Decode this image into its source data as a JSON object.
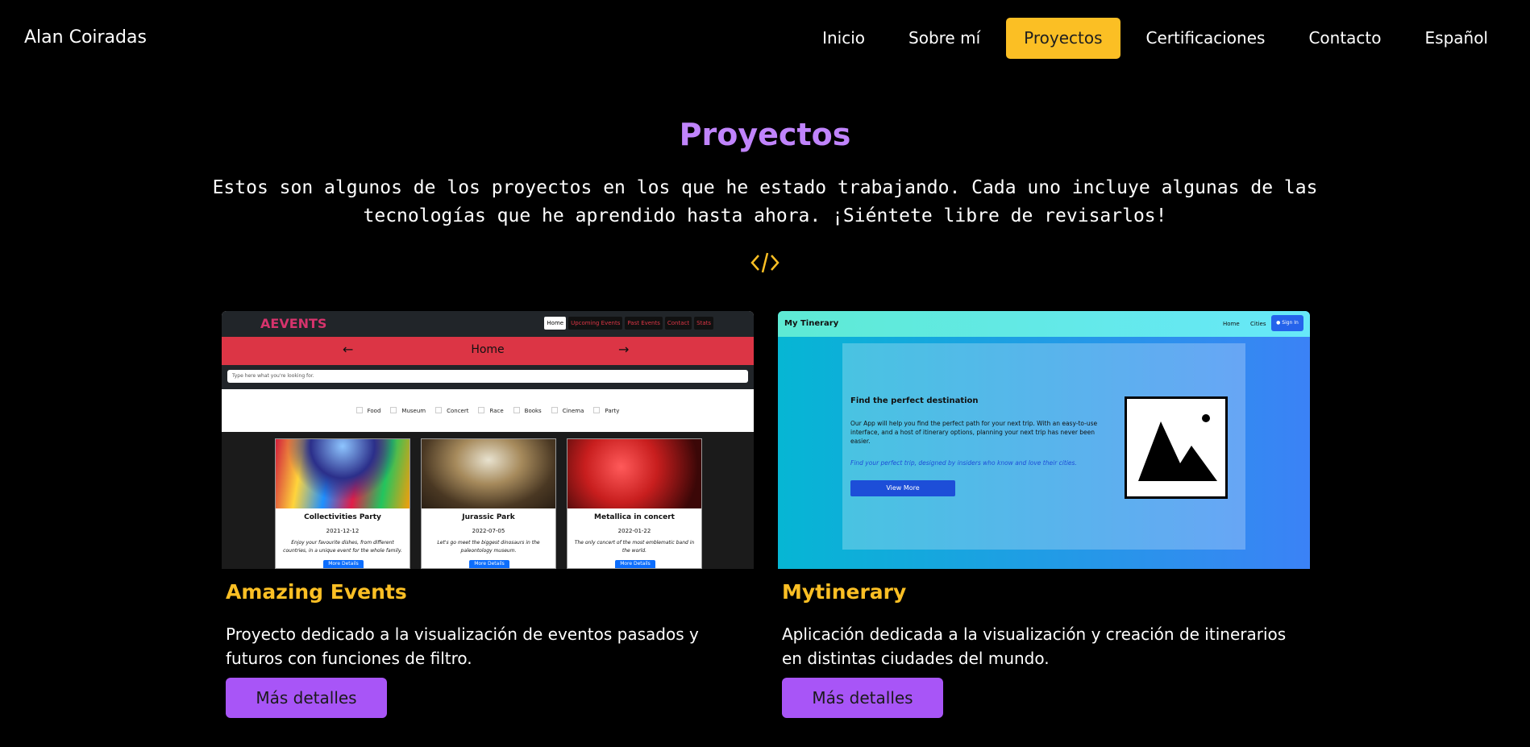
{
  "header": {
    "brand": "Alan Coiradas",
    "nav": [
      "Inicio",
      "Sobre mí",
      "Proyectos",
      "Certificaciones",
      "Contacto",
      "Español"
    ],
    "active_nav": "Proyectos"
  },
  "section": {
    "title": "Proyectos",
    "intro": "Estos son algunos de los proyectos en los que he estado trabajando. Cada uno incluye algunas de las tecnologías que he aprendido hasta ahora. ¡Siéntete libre de revisarlos!",
    "icon": "code-icon"
  },
  "colors": {
    "background": "#000000",
    "accent": "#fbbf24",
    "title": "#c084fc",
    "button": "#a855f7"
  },
  "projects": [
    {
      "title": "Amazing Events",
      "description": "Proyecto dedicado a la visualización de eventos pasados y futuros con funciones de filtro.",
      "button": "Más detalles",
      "preview": {
        "logo": "AEVENTS",
        "nav": [
          "Home",
          "Upcoming Events",
          "Past Events",
          "Contact",
          "Stats"
        ],
        "heading": "Home",
        "search_placeholder": "Type here what you're looking for.",
        "categories": [
          "Food",
          "Museum",
          "Concert",
          "Race",
          "Books",
          "Cinema",
          "Party"
        ],
        "events": [
          {
            "name": "Collectivities Party",
            "date": "2021-12-12",
            "text": "Enjoy your favourite dishes, from different countries, in a unique event for the whole family.",
            "button": "More Details"
          },
          {
            "name": "Jurassic Park",
            "date": "2022-07-05",
            "text": "Let's go meet the biggest dinosaurs in the paleontology museum.",
            "button": "More Details"
          },
          {
            "name": "Metallica in concert",
            "date": "2022-01-22",
            "text": "The only concert of the most emblematic band in the world.",
            "button": "More Details"
          }
        ]
      }
    },
    {
      "title": "Mytinerary",
      "description": "Aplicación dedicada a la visualización y creación de itinerarios en distintas ciudades del mundo.",
      "button": "Más detalles",
      "preview": {
        "brand": "My Tinerary",
        "nav": [
          "Home",
          "Cities"
        ],
        "signin": "Sign In",
        "heading": "Find the perfect destination",
        "text": "Our App will help you find the perfect path for your next trip. With an easy-to-use interface, and a host of itinerary options, planning your next trip has never been easier.",
        "tagline": "Find your perfect trip, designed by insiders who know and love their cities.",
        "button": "View More"
      }
    }
  ]
}
